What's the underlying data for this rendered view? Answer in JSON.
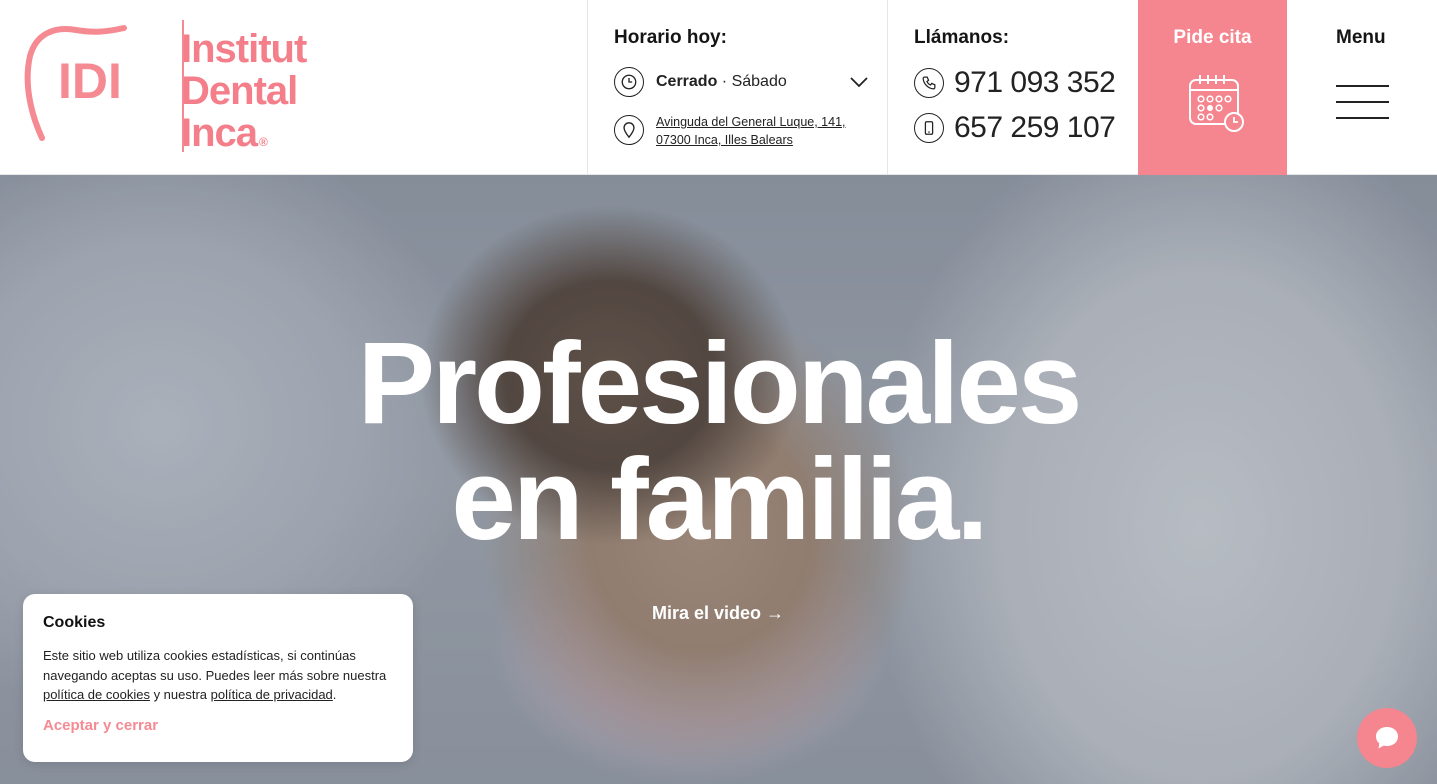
{
  "logo": {
    "monogram": "IDI",
    "line1": "Institut",
    "line2": "Dental",
    "line3": "Inca",
    "registered": "®"
  },
  "hours": {
    "title": "Horario hoy:",
    "status": "Cerrado",
    "day": " · Sábado",
    "address_line1": "Avinguda del General Luque, 141,",
    "address_line2": "07300 Inca, Illes Balears"
  },
  "phone": {
    "title": "Llámanos:",
    "landline": "971 093 352",
    "mobile": "657 259 107"
  },
  "cita": {
    "label": "Pide cita"
  },
  "menu": {
    "label": "Menu"
  },
  "hero": {
    "title_line1": "Profesionales",
    "title_line2": "en familia.",
    "video_link": "Mira el video →"
  },
  "cookies": {
    "title": "Cookies",
    "text1": "Este sitio web utiliza cookies estadísticas, si continúas navegando aceptas su uso. Puedes leer más sobre nuestra ",
    "link1": "política de cookies",
    "text2": " y nuestra ",
    "link2": "política de privacidad",
    "text3": ".",
    "accept": "Aceptar y cerrar"
  },
  "colors": {
    "brand_pink": "#f5858f",
    "text_dark": "#1a1a1a"
  },
  "icons": {
    "hours": "clock-icon",
    "address": "map-pin-icon",
    "landline": "phone-icon",
    "mobile": "smartphone-icon",
    "cita": "calendar-icon",
    "chat": "chat-bubble-icon",
    "dropdown": "chevron-down-icon"
  }
}
